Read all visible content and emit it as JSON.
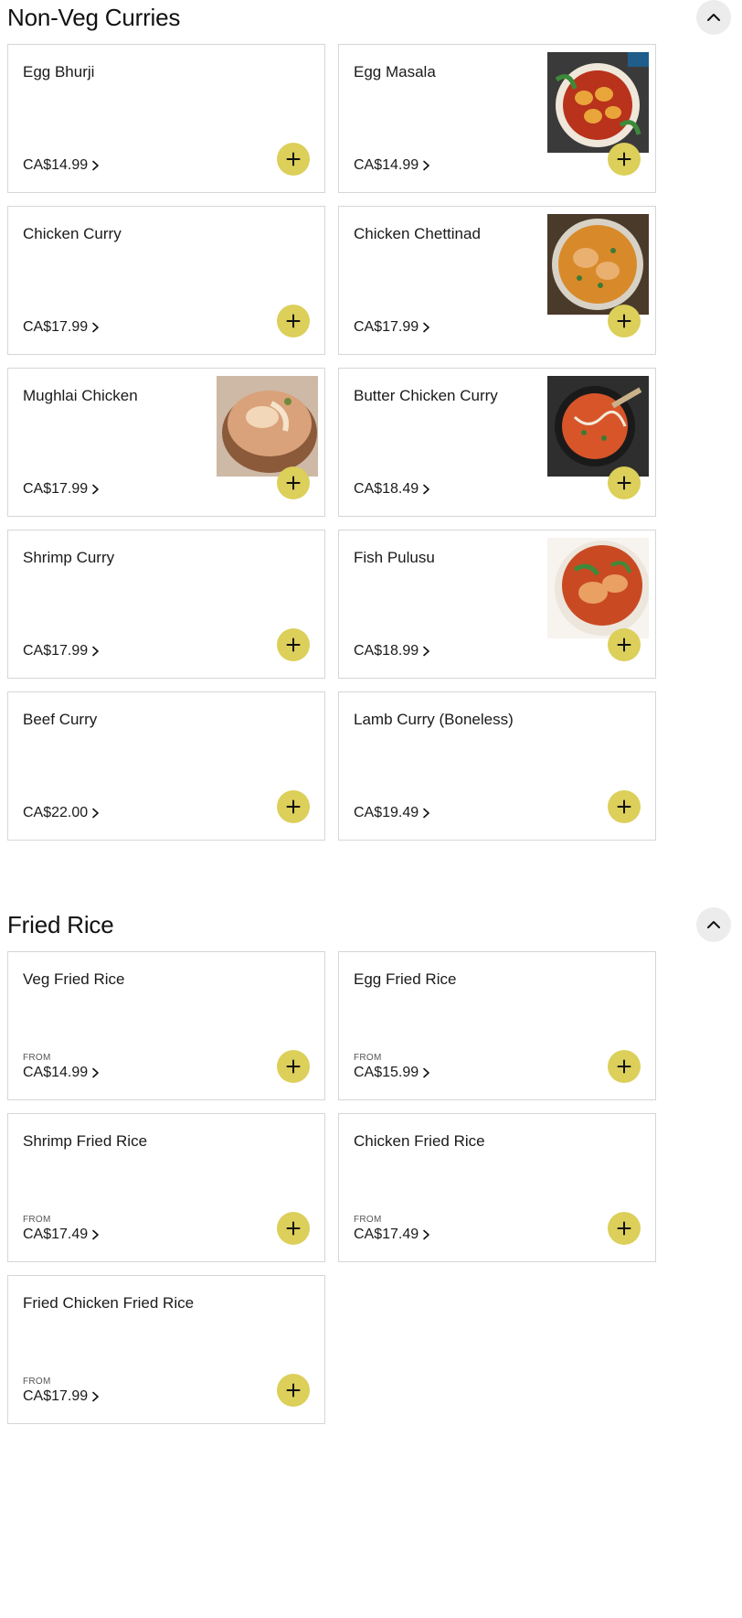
{
  "sections": [
    {
      "title": "Non-Veg Curries",
      "items": [
        {
          "name": "Egg Bhurji",
          "price": "CA$14.99",
          "from": ""
        },
        {
          "name": "Egg Masala",
          "price": "CA$14.99",
          "from": "",
          "image": "egg-masala-photo"
        },
        {
          "name": "Chicken Curry",
          "price": "CA$17.99",
          "from": ""
        },
        {
          "name": "Chicken Chettinad",
          "price": "CA$17.99",
          "from": "",
          "image": "chicken-chettinad-photo"
        },
        {
          "name": "Mughlai Chicken",
          "price": "CA$17.99",
          "from": "",
          "image": "mughlai-chicken-photo"
        },
        {
          "name": "Butter Chicken Curry",
          "price": "CA$18.49",
          "from": "",
          "image": "butter-chicken-photo"
        },
        {
          "name": "Shrimp Curry",
          "price": "CA$17.99",
          "from": ""
        },
        {
          "name": "Fish Pulusu",
          "price": "CA$18.99",
          "from": "",
          "image": "fish-pulusu-photo"
        },
        {
          "name": "Beef Curry",
          "price": "CA$22.00",
          "from": ""
        },
        {
          "name": "Lamb Curry (Boneless)",
          "price": "CA$19.49",
          "from": ""
        }
      ]
    },
    {
      "title": "Fried Rice",
      "items": [
        {
          "name": "Veg Fried Rice",
          "price": "CA$14.99",
          "from": "FROM"
        },
        {
          "name": "Egg Fried Rice",
          "price": "CA$15.99",
          "from": "FROM"
        },
        {
          "name": "Shrimp Fried Rice",
          "price": "CA$17.49",
          "from": "FROM"
        },
        {
          "name": "Chicken Fried Rice",
          "price": "CA$17.49",
          "from": "FROM"
        },
        {
          "name": "Fried Chicken Fried Rice",
          "price": "CA$17.99",
          "from": "FROM"
        }
      ]
    }
  ],
  "colors": {
    "add_button": "#dccf5a",
    "collapse_button": "#ececec",
    "card_border": "#d6d6d6"
  },
  "icons": {
    "collapse": "chevron-up-icon",
    "add": "plus-icon",
    "price_link": "chevron-right-icon"
  }
}
